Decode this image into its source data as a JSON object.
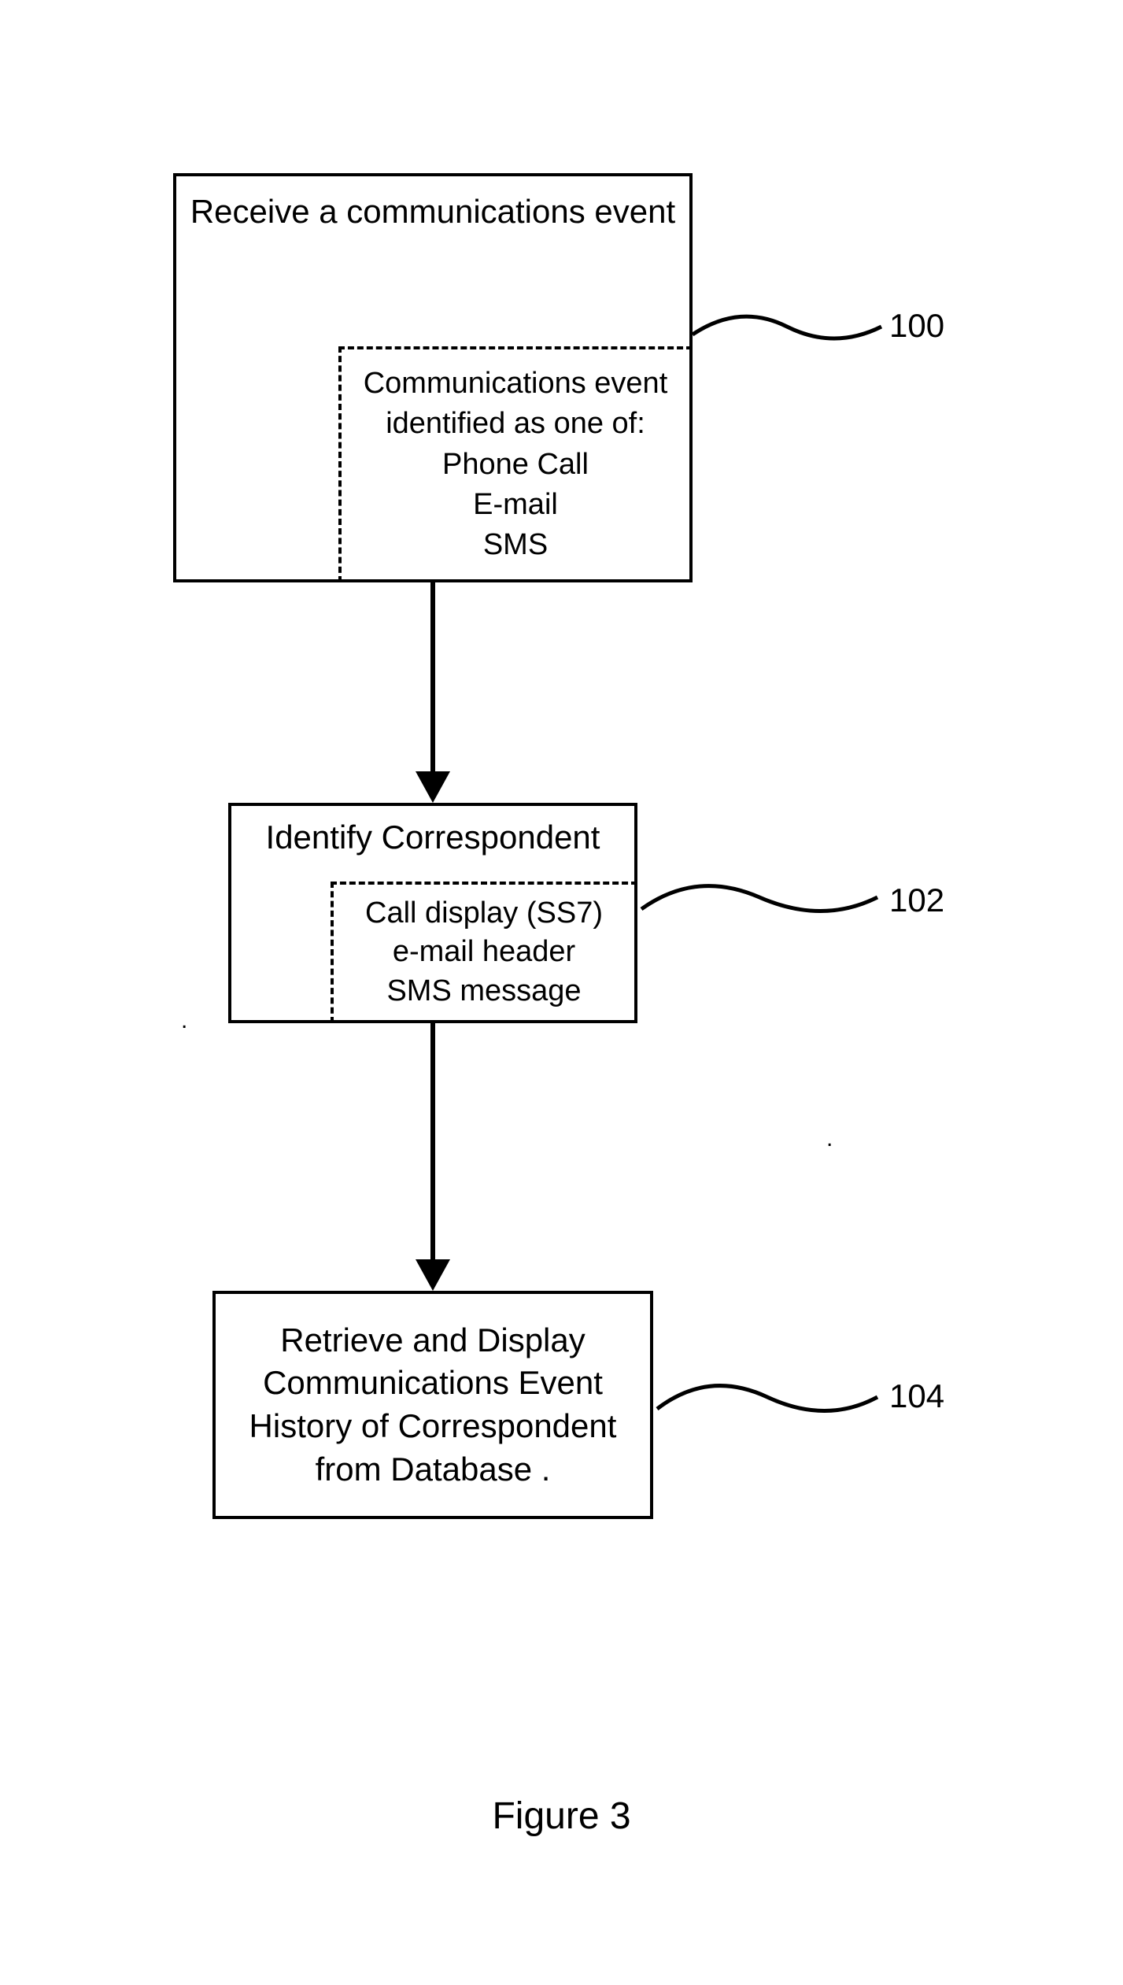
{
  "blocks": {
    "b1": {
      "title": "Receive a communications event",
      "inner_title": "Communications event identified as one of:",
      "inner_items": "Phone Call\nE-mail\nSMS",
      "ref": "100"
    },
    "b2": {
      "title": "Identify Correspondent",
      "inner_items": "Call display (SS7)\ne-mail header\nSMS message",
      "ref": "102"
    },
    "b3": {
      "text": "Retrieve and Display Communications Event History of Correspondent from Database .",
      "ref": "104"
    }
  },
  "caption": "Figure 3"
}
